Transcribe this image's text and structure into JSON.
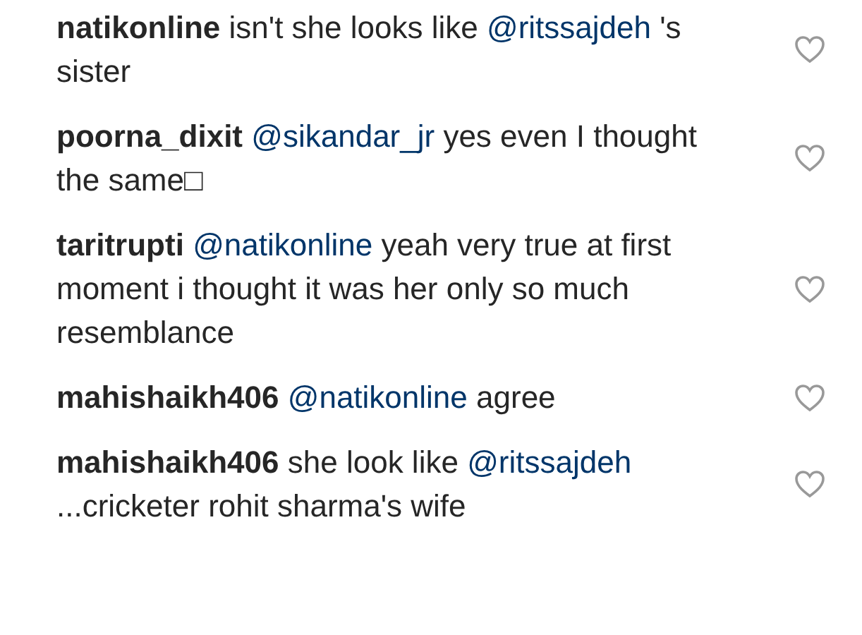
{
  "comments": [
    {
      "username": "natikonline",
      "parts": [
        {
          "kind": "text",
          "text": "isn't she looks like "
        },
        {
          "kind": "mention",
          "text": "@ritssajdeh"
        },
        {
          "kind": "text",
          "text": " 's sister"
        }
      ],
      "liked": false
    },
    {
      "username": "poorna_dixit",
      "parts": [
        {
          "kind": "mention",
          "text": "@sikandar_jr"
        },
        {
          "kind": "text",
          "text": " yes even I thought the same□"
        }
      ],
      "liked": false
    },
    {
      "username": "taritrupti",
      "parts": [
        {
          "kind": "mention",
          "text": "@natikonline"
        },
        {
          "kind": "text",
          "text": " yeah very true at first moment i thought it was her only so much resemblance"
        }
      ],
      "liked": false
    },
    {
      "username": "mahishaikh406",
      "parts": [
        {
          "kind": "mention",
          "text": "@natikonline"
        },
        {
          "kind": "text",
          "text": " agree"
        }
      ],
      "liked": false
    },
    {
      "username": "mahishaikh406",
      "parts": [
        {
          "kind": "text",
          "text": "she look like "
        },
        {
          "kind": "mention",
          "text": "@ritssajdeh"
        },
        {
          "kind": "text",
          "text": " ...cricketer rohit sharma's wife"
        }
      ],
      "liked": false
    }
  ]
}
